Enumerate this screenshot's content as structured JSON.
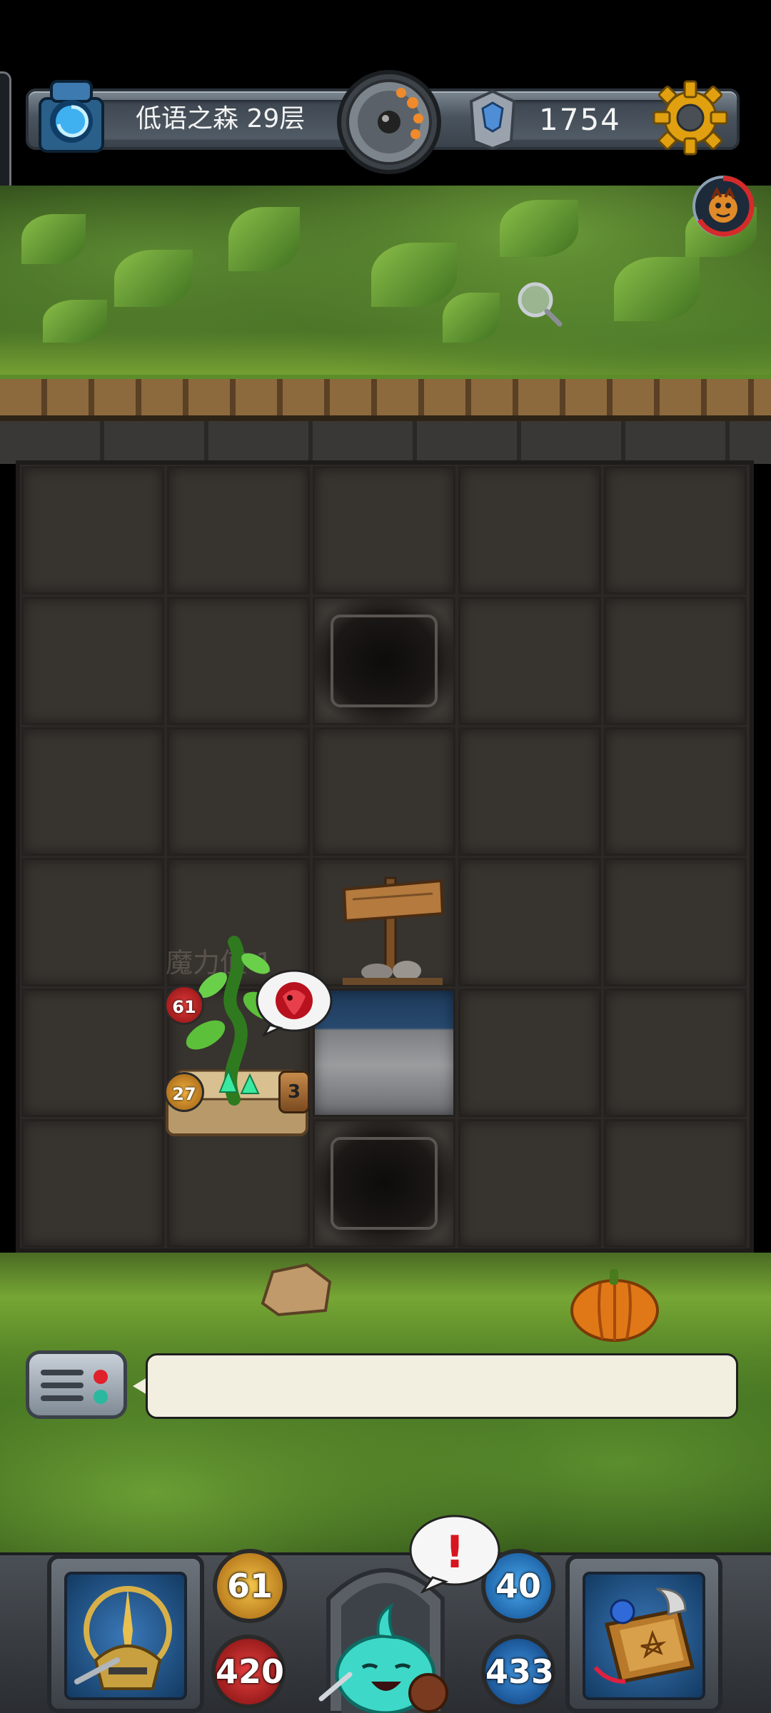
{
  "hud": {
    "floor_title": "低语之森 29层",
    "gold": "1754",
    "portal_icon": "portal-icon",
    "compass_icon": "compass-icon",
    "gem_icon": "rune-gem-icon",
    "settings_icon": "gear-icon",
    "boss_icon": "boss-portrait-icon"
  },
  "monster": {
    "name_watermark": "魔力值 1",
    "hp": "61",
    "attack": "27",
    "count": "3",
    "bubble_icon": "dragon-emblem-icon"
  },
  "message": {
    "text": ""
  },
  "player": {
    "attack": "61",
    "hp": "420",
    "defense": "40",
    "mp": "433",
    "alert": "!"
  },
  "colors": {
    "grass": "#5d8d2a",
    "floor_tile": "#37332f",
    "gold_orb": "#f5c64a",
    "hp_orb": "#e84040",
    "mana_orb": "#4aa8ee"
  }
}
